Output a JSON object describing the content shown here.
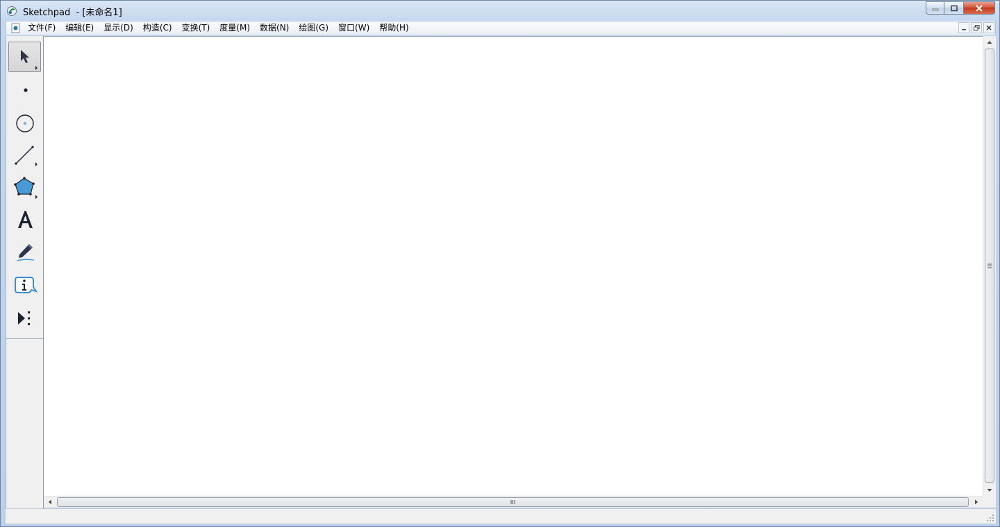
{
  "window": {
    "title": "Sketchpad  - [未命名1]"
  },
  "menu": {
    "items": [
      {
        "label": "文件(F)"
      },
      {
        "label": "编辑(E)"
      },
      {
        "label": "显示(D)"
      },
      {
        "label": "构造(C)"
      },
      {
        "label": "变换(T)"
      },
      {
        "label": "度量(M)"
      },
      {
        "label": "数据(N)"
      },
      {
        "label": "绘图(G)"
      },
      {
        "label": "窗口(W)"
      },
      {
        "label": "帮助(H)"
      }
    ]
  },
  "toolbox": {
    "tools": [
      {
        "icon": "arrow-select-icon",
        "selected": true
      },
      {
        "icon": "point-icon"
      },
      {
        "icon": "compass-circle-icon"
      },
      {
        "icon": "straightedge-line-icon"
      },
      {
        "icon": "polygon-icon"
      },
      {
        "icon": "text-icon"
      },
      {
        "icon": "marker-pen-icon"
      },
      {
        "icon": "information-icon"
      },
      {
        "icon": "custom-tool-icon"
      }
    ]
  },
  "colors": {
    "titlebar": "#c5d7ee",
    "canvas": "#ffffff",
    "toolbox": "#f0f0f0",
    "accent_blue": "#3a8fd0"
  }
}
